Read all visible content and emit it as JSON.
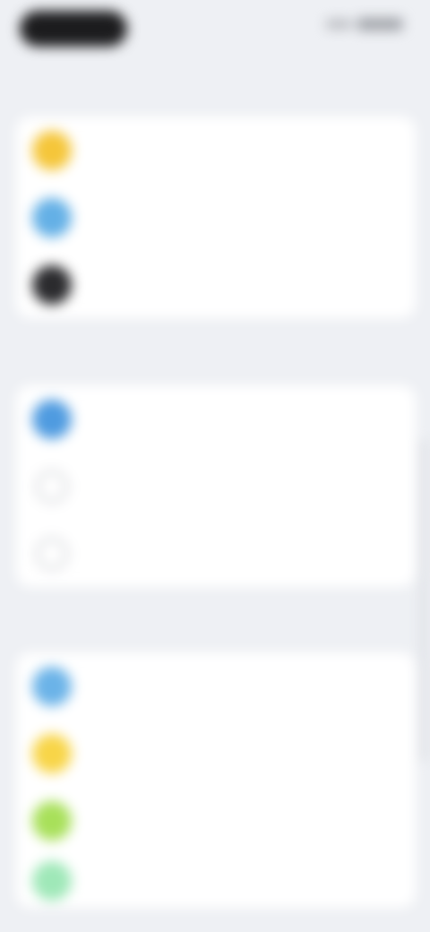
{
  "status": {
    "time": "",
    "signal_icon": "signal-icon",
    "battery_icon": "battery-icon"
  },
  "nav": {
    "title": ""
  },
  "groups": [
    {
      "header": "",
      "items": [
        {
          "label": "",
          "icon": "sun-icon",
          "color": "#f5c63a"
        },
        {
          "label": "",
          "icon": "display-icon",
          "color": "#64b0e6"
        },
        {
          "label": "",
          "icon": "moon-icon",
          "color": "#2b2b2e"
        }
      ]
    },
    {
      "header": "",
      "items": [
        {
          "label": "",
          "icon": "adaptive-icon",
          "color": "#4f9be0"
        },
        {
          "label": "",
          "icon": "circle-outline-icon",
          "color": "#c9cbd0"
        },
        {
          "label": "",
          "icon": "circle-outline-icon",
          "color": "#c9cbd0"
        }
      ]
    },
    {
      "header": "",
      "items": [
        {
          "label": "",
          "icon": "wallpaper-icon",
          "color": "#6bb3e8"
        },
        {
          "label": "",
          "icon": "theme-icon",
          "color": "#f8d548"
        },
        {
          "label": "",
          "icon": "leaf-icon",
          "color": "#a8e05a"
        },
        {
          "label": "",
          "icon": "eye-icon",
          "color": "#9fe8b8"
        }
      ]
    }
  ]
}
